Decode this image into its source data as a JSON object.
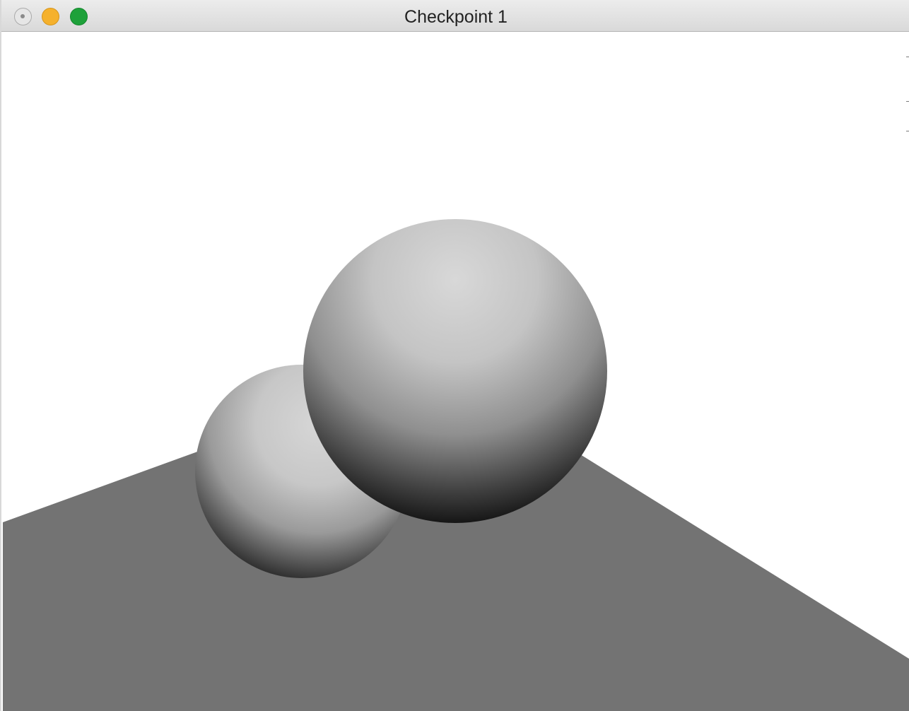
{
  "window": {
    "title": "Checkpoint 1",
    "controls": {
      "close": "close-button",
      "minimize": "minimize-button",
      "zoom": "zoom-button"
    },
    "colors": {
      "close": "#e6e6e6",
      "minimize": "#f5b12d",
      "zoom": "#1ea13a"
    }
  },
  "scene": {
    "background_color": "#ffffff",
    "floor_color": "#737373",
    "sphere_highlight_color": "#d6d6d6",
    "sphere_shadow_color": "#050505"
  }
}
